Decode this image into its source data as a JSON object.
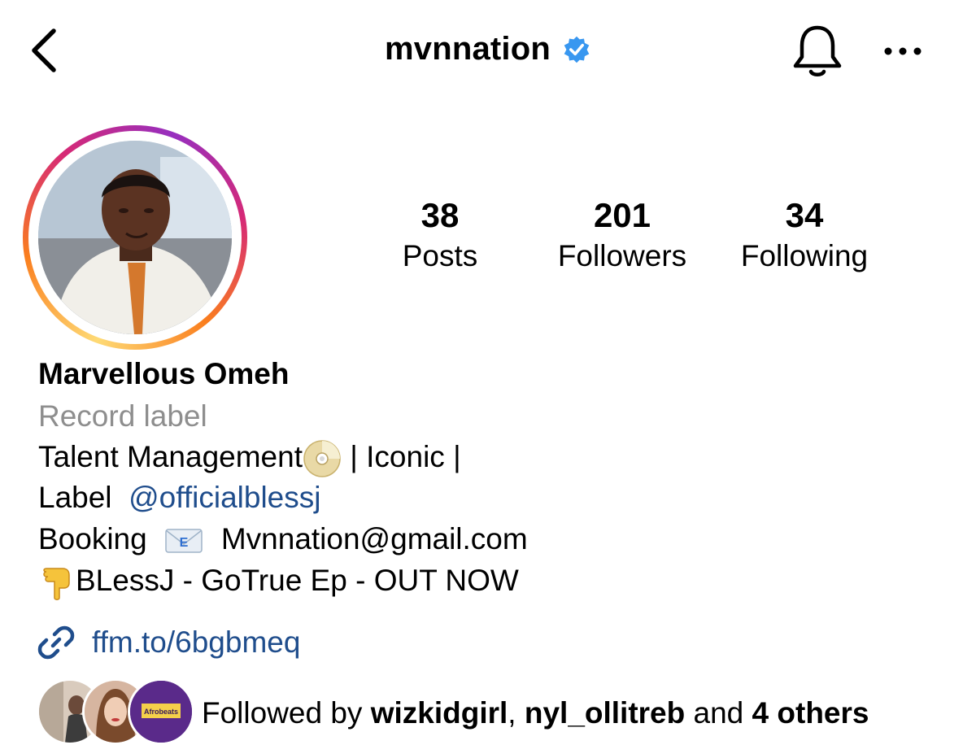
{
  "header": {
    "username": "mvnnation",
    "icons": {
      "back": "chevron-left-icon",
      "verified": "verified-badge-icon",
      "notifications": "bell-icon",
      "more": "more-horizontal-icon"
    },
    "verified_color": "#3897f0"
  },
  "profile": {
    "stats": [
      {
        "value": "38",
        "label": "Posts"
      },
      {
        "value": "201",
        "label": "Followers"
      },
      {
        "value": "34",
        "label": "Following"
      }
    ],
    "name": "Marvellous Omeh",
    "category": "Record label",
    "bio": {
      "line1_text": "Talent Management",
      "line1_suffix": " | Iconic |",
      "line2_prefix": "Label",
      "line2_mention": "@officialblessj",
      "line3_prefix": "Booking",
      "line3_email": "Mvnnation@gmail.com",
      "line4_text": "BLessJ  - GoTrue Ep - OUT NOW"
    },
    "emojis": {
      "line1": "dvd-emoji",
      "line3": "envelope-emoji",
      "line4": "pointing-down-emoji"
    },
    "link": {
      "icon": "link-icon",
      "text": "ffm.to/6bgbmeq"
    },
    "followed_by": {
      "prefix": "Followed by ",
      "user1": "wizkidgirl",
      "separator": ", ",
      "user2": "nyl_ollitreb",
      "middle": " and ",
      "others": "4 others"
    },
    "avatar_text": "Afrobeats"
  },
  "colors": {
    "link": "#1f4d8c",
    "category": "#8e8e8e",
    "story_ring": [
      "#feda75",
      "#fa7e1e",
      "#d62976",
      "#962fbf"
    ]
  }
}
